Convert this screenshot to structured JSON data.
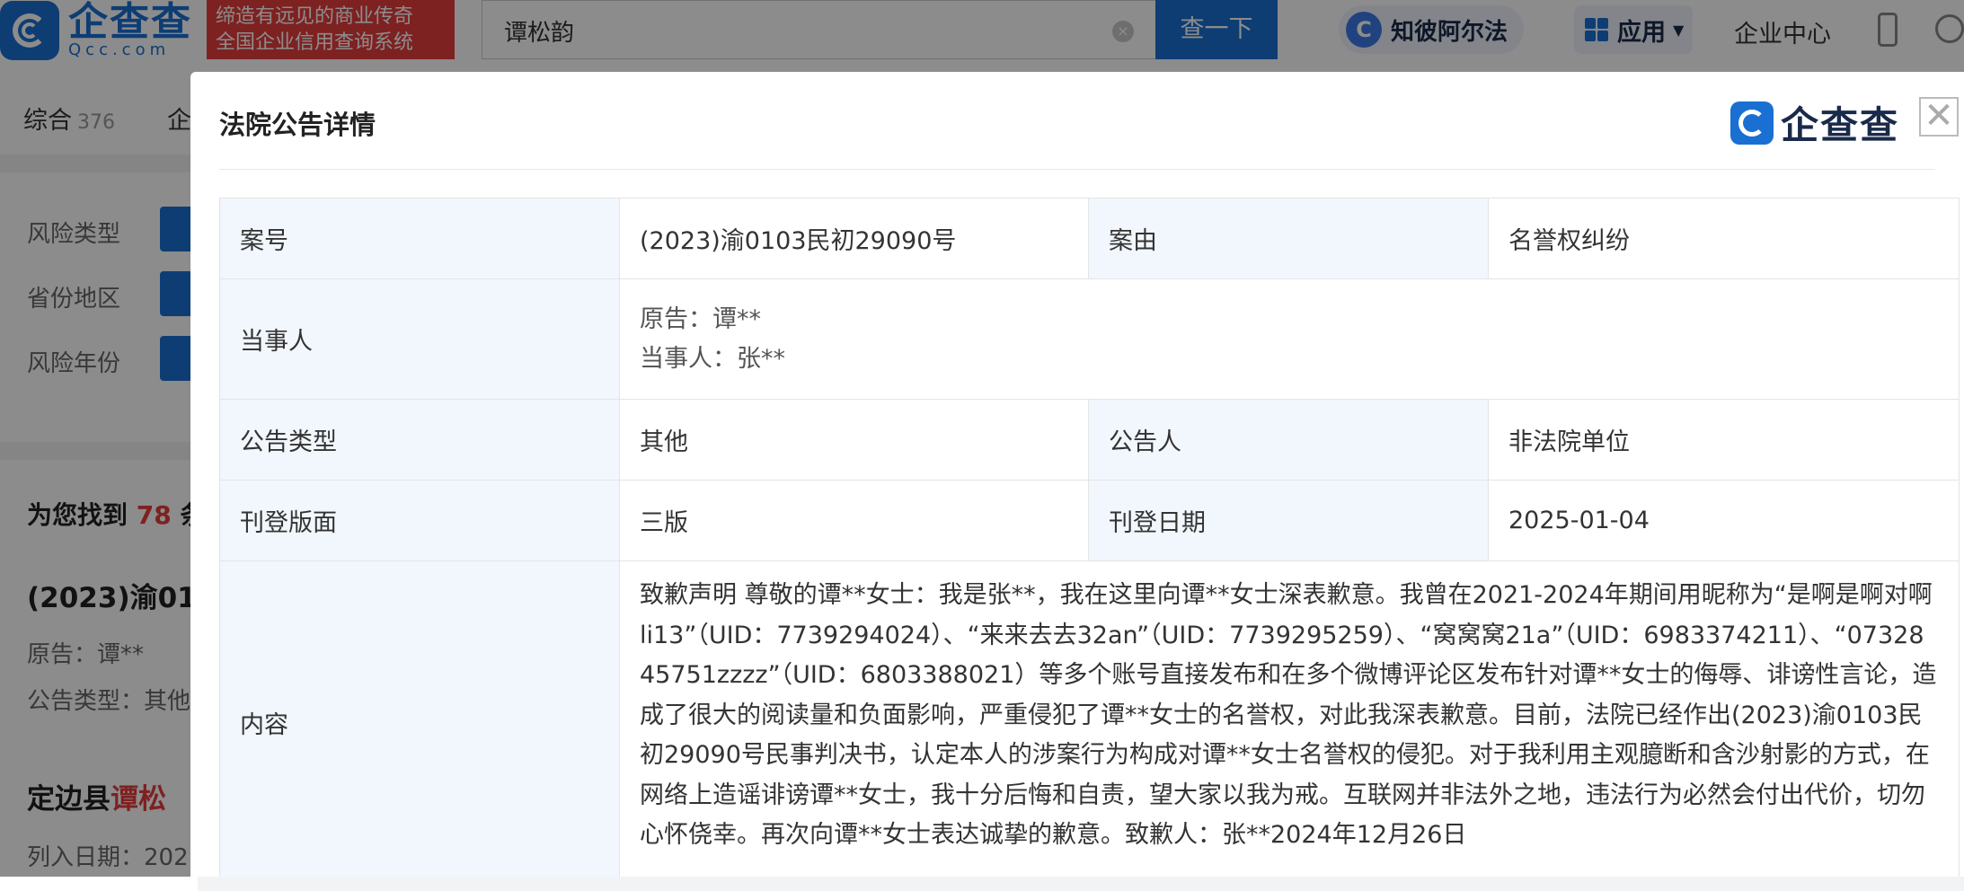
{
  "header": {
    "logo_cn": "企查查",
    "logo_en": "Qcc.com",
    "slogan_line1": "缔造有远见的商业传奇",
    "slogan_line2": "全国企业信用查询系统",
    "search_value": "谭松韵",
    "search_button": "查一下",
    "zhibi_label": "知彼阿尔法",
    "zhibi_icon": "c-logo-icon",
    "apps_label": "应用",
    "corp_center": "企业中心"
  },
  "background": {
    "tabs": [
      {
        "label": "综合",
        "count": "376"
      },
      {
        "label": "企"
      }
    ],
    "filters": [
      {
        "label": "风险类型"
      },
      {
        "label": "省份地区"
      },
      {
        "label": "风险年份"
      }
    ],
    "found_prefix": "为您找到",
    "found_count": "78",
    "found_suffix": "条",
    "result1_title": "(2023)渝01",
    "result1_plaintiff": "原告：谭**",
    "result1_type": "公告类型：其他",
    "result2_title_prefix": "定边县",
    "result2_title_hl": "谭松",
    "result2_date": "列入日期：202"
  },
  "modal": {
    "title": "法院公告详情",
    "brand_text": "企查查",
    "close_glyph": "✕",
    "rows": {
      "case_no_label": "案号",
      "case_no_value": "(2023)渝0103民初29090号",
      "cause_label": "案由",
      "cause_value": "名誉权纠纷",
      "parties_label": "当事人",
      "plaintiff": "原告：谭**",
      "party": "当事人：张**",
      "type_label": "公告类型",
      "type_value": "其他",
      "announcer_label": "公告人",
      "announcer_value": "非法院单位",
      "page_label": "刊登版面",
      "page_value": "三版",
      "date_label": "刊登日期",
      "date_value": "2025-01-04",
      "content_label": "内容",
      "content_value": "致歉声明 尊敬的谭**女士：我是张**，我在这里向谭**女士深表歉意。我曾在2021-2024年期间用昵称为“是啊是啊对啊li13”（UID：7739294024）、“来来去去32an”（UID：7739295259）、“窝窝窝21a”（UID：6983374211）、“0732845751zzzz”（UID：6803388021）等多个账号直接发布和在多个微博评论区发布针对谭**女士的侮辱、诽谤性言论，造成了很大的阅读量和负面影响，严重侵犯了谭**女士的名誉权，对此我深表歉意。目前，法院已经作出(2023)渝0103民初29090号民事判决书，认定本人的涉案行为构成对谭**女士名誉权的侵犯。对于我利用主观臆断和含沙射影的方式，在网络上造谣诽谤谭**女士，我十分后悔和自责，望大家以我为戒。互联网并非法外之地，违法行为必然会付出代价，切勿心怀侥幸。再次向谭**女士表达诚挚的歉意。致歉人：张**2024年12月26日"
    }
  },
  "colors": {
    "brand_blue": "#1a6fd3",
    "slogan_red": "#e63d3d",
    "label_bg": "#f2f7fd"
  }
}
